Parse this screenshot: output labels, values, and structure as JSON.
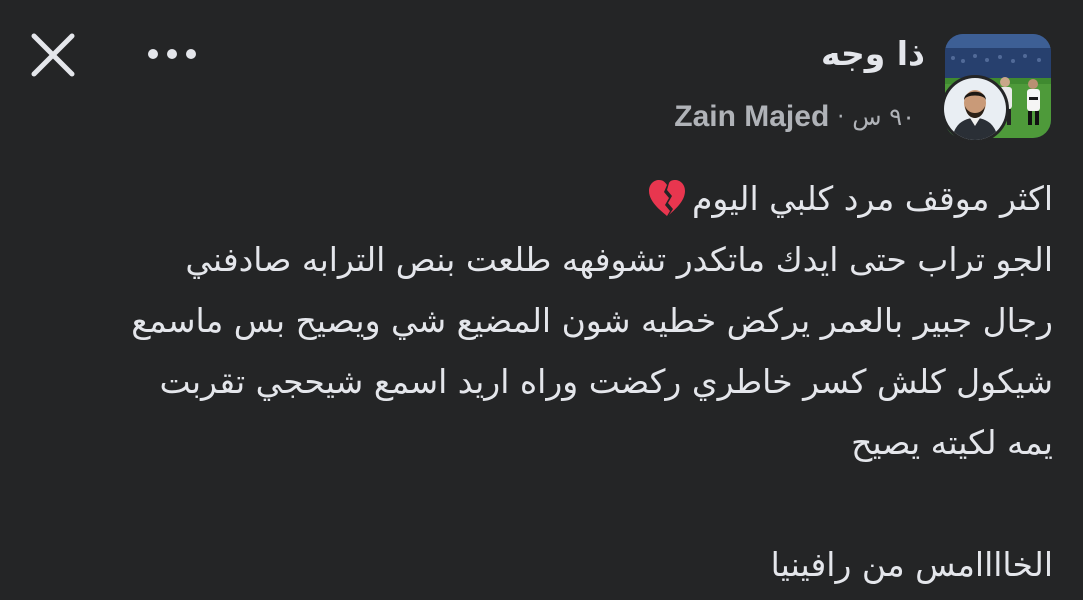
{
  "header": {
    "close_icon": "close-icon",
    "more_icon": "more-horizontal-icon",
    "page_name": "ذا وجه",
    "author_name": "Zain Majed",
    "separator": "·",
    "time": "٩٠ س"
  },
  "post": {
    "lines": [
      "اكثر موقف مرد كلبي اليوم",
      "الجو تراب حتى ايدك ماتكدر تشوفهه طلعت بنص الترابه صادفني",
      "رجال جبير بالعمر يركض خطيه شون المضيع شي ويصيح بس ماسمع",
      "شيكول كلش كسر خاطري ركضت وراه اريد  اسمع شيحجي تقربت",
      "يمه لكيته يصيح",
      "",
      "الخاااامس من رافينيا"
    ],
    "emoji_icon": "broken-heart-icon"
  },
  "colors": {
    "background": "#242526",
    "primary_text": "#e4e6eb",
    "secondary_text": "#b0b3b8",
    "heart": "#e8364f"
  }
}
